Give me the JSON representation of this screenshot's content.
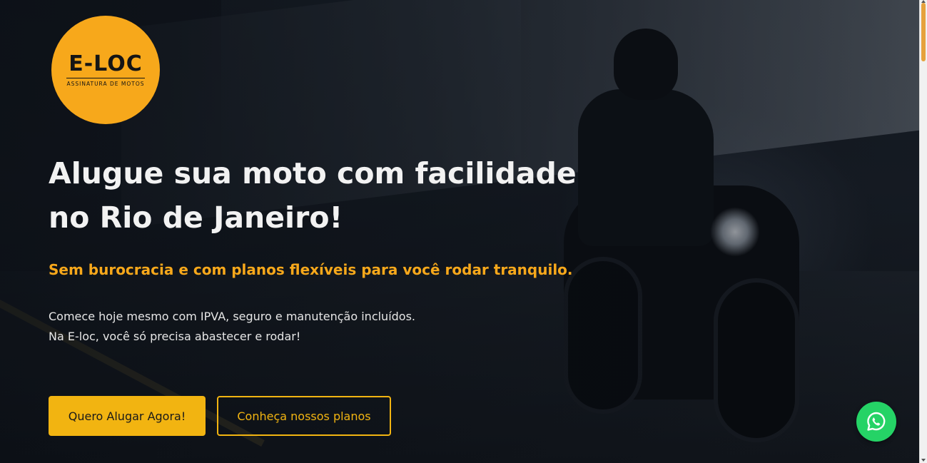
{
  "brand": {
    "wordmark": "E-LOC",
    "tagline": "ASSINATURA DE MOTOS",
    "color": "#f7a81b"
  },
  "hero": {
    "headline_line1": "Alugue sua moto com facilidade",
    "headline_line2": "no Rio de Janeiro!",
    "subheadline": "Sem burocracia e com planos flexíveis para você rodar tranquilo.",
    "description_line1": "Comece hoje mesmo com IPVA, seguro e manutenção incluídos.",
    "description_line2": "Na E-loc, você só precisa abastecer e rodar!"
  },
  "actions": {
    "primary_label": "Quero Alugar Agora!",
    "secondary_label": "Conheça nossos planos"
  },
  "floating": {
    "whatsapp_icon": "whatsapp-icon",
    "color": "#25d366"
  },
  "colors": {
    "accent": "#f2b411",
    "headline": "#f2f2f2"
  }
}
